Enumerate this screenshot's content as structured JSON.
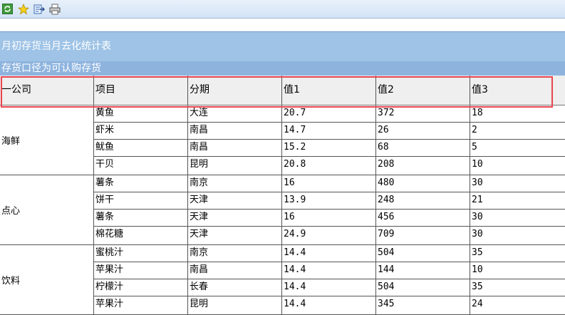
{
  "toolbar": {
    "buttons": [
      {
        "icon": "refresh-icon"
      },
      {
        "icon": "star-icon"
      },
      {
        "icon": "export-icon"
      },
      {
        "icon": "print-icon"
      }
    ]
  },
  "report": {
    "title": "月初存货当月去化统计表",
    "subtitle": "存货口径为可认购存货"
  },
  "table": {
    "headers": [
      "一公司",
      "项目",
      "分期",
      "值1",
      "值2",
      "值3"
    ],
    "groups": [
      {
        "name": "海鲜",
        "rows": [
          [
            "黄鱼",
            "大连",
            "20.7",
            "372",
            "18"
          ],
          [
            "虾米",
            "南昌",
            "14.7",
            "26",
            "2"
          ],
          [
            "鱿鱼",
            "南昌",
            "15.2",
            "68",
            "5"
          ],
          [
            "干贝",
            "昆明",
            "20.8",
            "208",
            "10"
          ]
        ]
      },
      {
        "name": "点心",
        "rows": [
          [
            "薯条",
            "南京",
            "16",
            "480",
            "30"
          ],
          [
            "饼干",
            "天津",
            "13.9",
            "248",
            "21"
          ],
          [
            "薯条",
            "天津",
            "16",
            "456",
            "30"
          ],
          [
            "棉花糖",
            "天津",
            "24.9",
            "709",
            "30"
          ]
        ]
      },
      {
        "name": "饮料",
        "rows": [
          [
            "蜜桃汁",
            "南京",
            "14.4",
            "504",
            "35"
          ],
          [
            "苹果汁",
            "南昌",
            "14.4",
            "144",
            "10"
          ],
          [
            "柠檬汁",
            "长春",
            "14.4",
            "504",
            "35"
          ],
          [
            "苹果汁",
            "昆明",
            "14.4",
            "345",
            "24"
          ]
        ]
      }
    ]
  }
}
